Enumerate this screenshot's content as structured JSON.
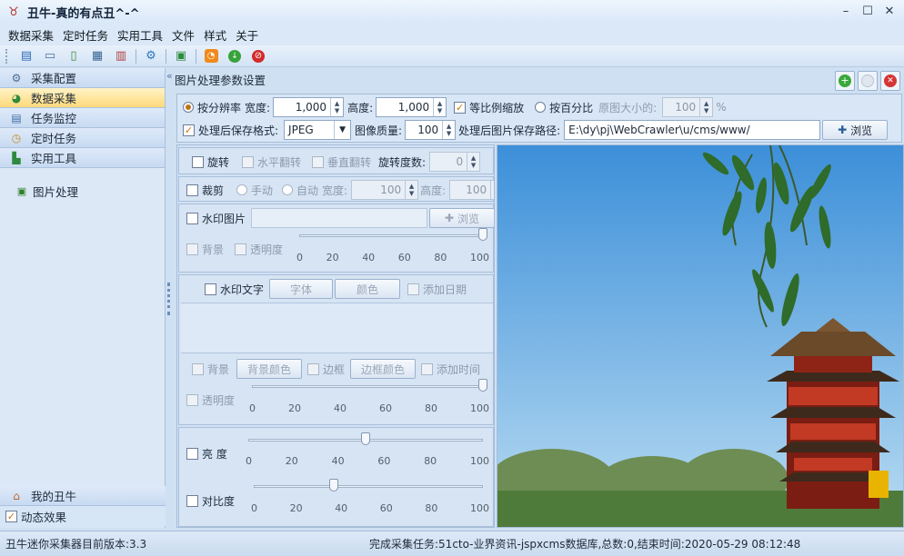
{
  "window": {
    "title": "丑牛-真的有点丑^-^",
    "controls": [
      "minimize-icon",
      "maximize-icon",
      "close-icon"
    ]
  },
  "menu": [
    "数据采集",
    "定时任务",
    "实用工具",
    "文件",
    "样式",
    "关于"
  ],
  "toolbar_icons": [
    "new-task-icon",
    "import-icon",
    "export-icon",
    "database-icon",
    "save-icon",
    "settings-icon",
    "image-icon",
    "rss-icon",
    "start-icon",
    "stop-icon"
  ],
  "sidebar": {
    "items": [
      {
        "label": "采集配置",
        "icon": "gear-icon"
      },
      {
        "label": "数据采集",
        "icon": "globe-icon",
        "active": true
      },
      {
        "label": "任务监控",
        "icon": "monitor-icon"
      },
      {
        "label": "定时任务",
        "icon": "clock-icon"
      },
      {
        "label": "实用工具",
        "icon": "tools-icon"
      }
    ],
    "tool_items": [
      {
        "label": "图片处理",
        "icon": "image-process-icon"
      }
    ],
    "bottom": {
      "home_label": "我的丑牛",
      "effects_label": "动态效果",
      "effects_checked": true
    }
  },
  "main": {
    "title": "图片处理参数设置",
    "header_buttons": [
      "add-icon",
      "disabled-icon",
      "close-icon"
    ],
    "resolution": {
      "radio_label": "按分辨率",
      "width_label": "宽度:",
      "width": "1,000",
      "height_label": "高度:",
      "height": "1,000",
      "proportional_label": "等比例缩放",
      "proportional_checked": true,
      "percent_label": "按百分比",
      "original_label": "原图大小的:",
      "percent_value": "100",
      "percent_unit": "%"
    },
    "save": {
      "format_label": "处理后保存格式:",
      "format": "JPEG",
      "quality_label": "图像质量:",
      "quality": "100",
      "path_label": "处理后图片保存路径:",
      "path": "E:\\dy\\pj\\WebCrawler\\u/cms/www/",
      "browse_label": "浏览"
    },
    "rotate": {
      "label": "旋转",
      "hflip_label": "水平翻转",
      "vflip_label": "垂直翻转",
      "degree_label": "旋转度数:",
      "degree": "0"
    },
    "crop": {
      "label": "裁剪",
      "manual_label": "手动",
      "auto_label": "自动",
      "width_label": "宽度:",
      "width": "100",
      "height_label": "高度:",
      "height": "100"
    },
    "watermark_image": {
      "label": "水印图片",
      "browse_label": "浏览",
      "bg_label": "背景",
      "opacity_label": "透明度",
      "opacity": 100,
      "ticks": [
        "0",
        "20",
        "40",
        "60",
        "80",
        "100"
      ]
    },
    "watermark_text": {
      "label": "水印文字",
      "font_label": "字体",
      "color_label": "颜色",
      "add_date_label": "添加日期",
      "bg_label": "背景",
      "bg_color_label": "背景颜色",
      "border_label": "边框",
      "border_color_label": "边框颜色",
      "add_time_label": "添加时间",
      "opacity_label": "透明度",
      "opacity": 100,
      "ticks": [
        "0",
        "20",
        "40",
        "60",
        "80",
        "100"
      ]
    },
    "brightness": {
      "label": "亮 度",
      "value": 50,
      "ticks": [
        "0",
        "20",
        "40",
        "60",
        "80",
        "100"
      ]
    },
    "contrast": {
      "label": "对比度",
      "value": 35,
      "ticks": [
        "0",
        "20",
        "40",
        "60",
        "80",
        "100"
      ]
    }
  },
  "status": {
    "left": "丑牛迷你采集器目前版本:3.3",
    "right": "完成采集任务:51cto-业界资讯-jspxcms数据库,总数:0,结束时间:2020-05-29 08:12:48"
  }
}
